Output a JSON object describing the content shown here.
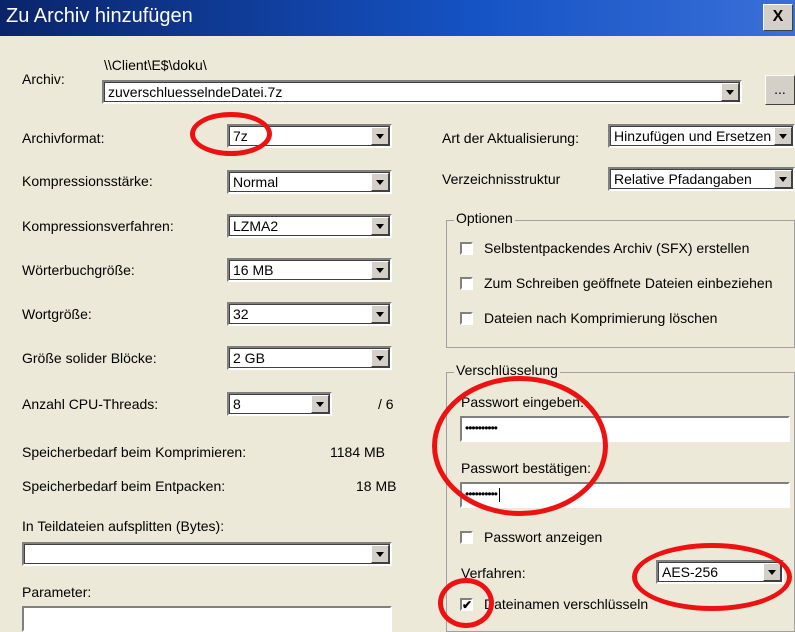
{
  "window": {
    "title": "Zu Archiv hinzufügen",
    "close": "X"
  },
  "archive": {
    "label": "Archiv:",
    "path": "\\\\Client\\E$\\doku\\",
    "filename": "zuverschluesselndeDatei.7z",
    "browse": "..."
  },
  "left": {
    "format": {
      "label": "Archivformat:",
      "value": "7z"
    },
    "level": {
      "label": "Kompressionsstärke:",
      "value": "Normal"
    },
    "method": {
      "label": "Kompressionsverfahren:",
      "value": "LZMA2"
    },
    "dict": {
      "label": "Wörterbuchgröße:",
      "value": "16 MB"
    },
    "word": {
      "label": "Wortgröße:",
      "value": "32"
    },
    "solid": {
      "label": "Größe solider Blöcke:",
      "value": "2 GB"
    },
    "threads": {
      "label": "Anzahl CPU-Threads:",
      "value": "8",
      "max": "/ 6"
    },
    "mem_compress": {
      "label": "Speicherbedarf beim Komprimieren:",
      "value": "1184 MB"
    },
    "mem_extract": {
      "label": "Speicherbedarf beim Entpacken:",
      "value": "18 MB"
    },
    "split": {
      "label": "In Teildateien aufsplitten (Bytes):",
      "value": ""
    },
    "params": {
      "label": "Parameter:",
      "value": ""
    }
  },
  "right": {
    "update": {
      "label": "Art der Aktualisierung:",
      "value": "Hinzufügen und Ersetzen"
    },
    "pathmode": {
      "label": "Verzeichnisstruktur",
      "value": "Relative Pfadangaben"
    },
    "options": {
      "title": "Optionen",
      "sfx": "Selbstentpackendes Archiv (SFX) erstellen",
      "shared": "Zum Schreiben geöffnete Dateien einbeziehen",
      "delete": "Dateien nach Komprimierung löschen"
    },
    "encryption": {
      "title": "Verschlüsselung",
      "pw_label": "Passwort eingeben:",
      "pw_value": "••••••••••",
      "pw2_label": "Passwort bestätigen:",
      "pw2_value": "••••••••••",
      "show_label": "Passwort anzeigen",
      "method_label": "Verfahren:",
      "method_value": "AES-256",
      "encnames_label": "Dateinamen verschlüsseln",
      "encnames_checked": "✔"
    }
  },
  "colors": {
    "annotation": "#e11111",
    "titlebar": "#0a246a",
    "dialog": "#ece9d8"
  }
}
